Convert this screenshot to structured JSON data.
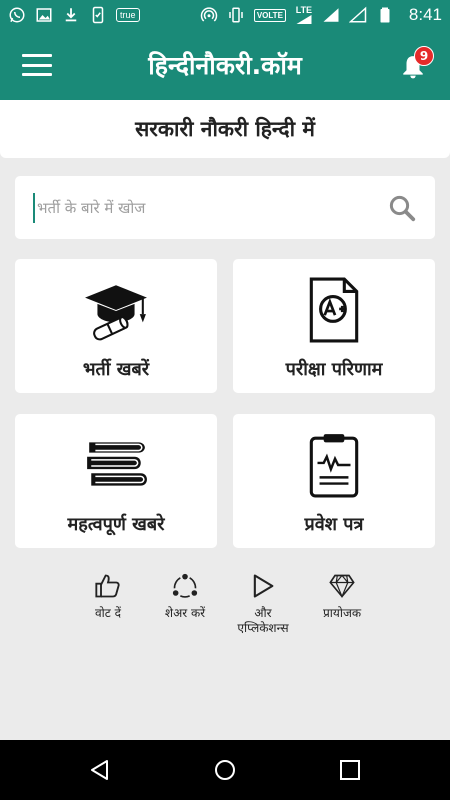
{
  "status_bar": {
    "time": "8:41",
    "true_label": "true",
    "volte_label": "VOLTE",
    "lte_label": "LTE",
    "icons": [
      "whatsapp-icon",
      "image-icon",
      "download-icon",
      "phone-icon",
      "true-badge",
      "hotspot-icon",
      "vibrate-icon",
      "volte-badge",
      "lte-signal-icon",
      "wifi-signal-icon",
      "signal-icon",
      "battery-icon"
    ]
  },
  "app_bar": {
    "title": "हिन्दीनौकरी.कॉम",
    "notification_count": "9",
    "menu_icon": "hamburger-menu-icon",
    "bell_icon": "bell-icon"
  },
  "subtitle": "सरकारी नौकरी हिन्दी में",
  "search": {
    "placeholder": "भर्ती के बारे में खोज",
    "value": ""
  },
  "cards": [
    {
      "label": "भर्ती खबरें",
      "icon": "graduation-cap-icon"
    },
    {
      "label": "परीक्षा परिणाम",
      "icon": "exam-result-icon"
    },
    {
      "label": "महत्वपूर्ण खबरे",
      "icon": "books-icon"
    },
    {
      "label": "प्रवेश पत्र",
      "icon": "admit-card-icon"
    }
  ],
  "actions": [
    {
      "label": "वोट दें",
      "icon": "thumbs-up-icon"
    },
    {
      "label": "शेअर करें",
      "icon": "share-icon"
    },
    {
      "label": "और एप्लिकेशन्स",
      "icon": "play-icon"
    },
    {
      "label": "प्रायोजक",
      "icon": "diamond-icon"
    }
  ],
  "colors": {
    "primary": "#1a8a78",
    "badge": "#e52a2a",
    "background": "#ebebeb",
    "card": "#ffffff"
  }
}
